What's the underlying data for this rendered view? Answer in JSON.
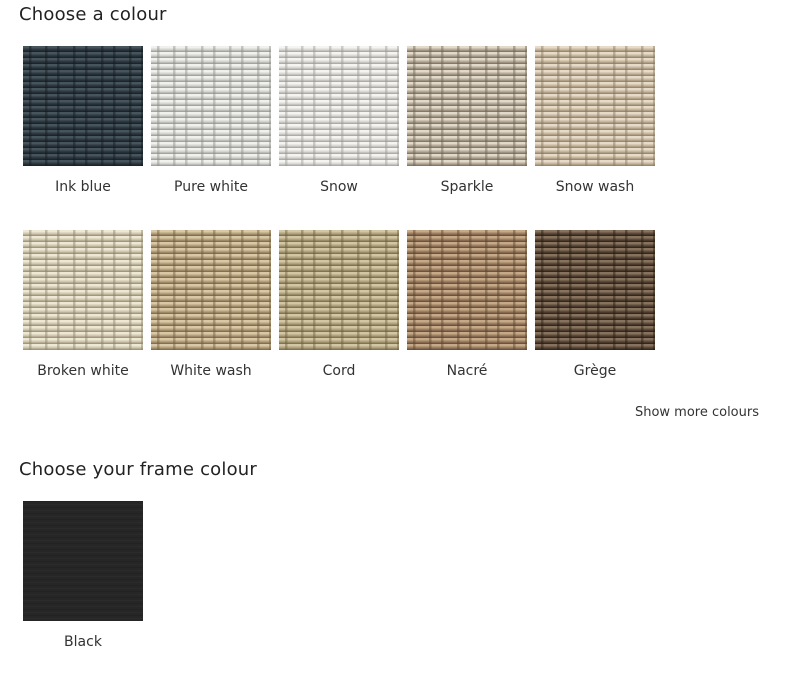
{
  "sections": {
    "weave": {
      "title": "Choose a colour",
      "show_more": "Show more colours",
      "swatches": [
        {
          "name": "Ink blue",
          "base": "#2d3940",
          "light": "#4b5960",
          "dark": "#141b20"
        },
        {
          "name": "Pure white",
          "base": "#d4d4d0",
          "light": "#f4f4f2",
          "dark": "#8f8f8c"
        },
        {
          "name": "Snow",
          "base": "#dcdad6",
          "light": "#f8f8f6",
          "dark": "#9a9894"
        },
        {
          "name": "Sparkle",
          "base": "#b8ab9a",
          "light": "#e8e0d2",
          "dark": "#6e6253"
        },
        {
          "name": "Snow wash",
          "base": "#c7b79e",
          "light": "#ebe1cf",
          "dark": "#85765f"
        },
        {
          "name": "Broken white",
          "base": "#d0c8b0",
          "light": "#f2ecda",
          "dark": "#8c8168"
        },
        {
          "name": "White wash",
          "base": "#b59f7c",
          "light": "#dfcfae",
          "dark": "#6f5b3e"
        },
        {
          "name": "Cord",
          "base": "#b1a37e",
          "light": "#d9cda8",
          "dark": "#6b5f40"
        },
        {
          "name": "Nacré",
          "base": "#9c7e60",
          "light": "#cdb08f",
          "dark": "#5a4230"
        },
        {
          "name": "Grège",
          "base": "#5b4a3a",
          "light": "#8f7a64",
          "dark": "#231a12"
        }
      ]
    },
    "frame": {
      "title": "Choose your frame colour",
      "swatches": [
        {
          "name": "Black",
          "base": "#262626",
          "light": "#2f2f2f",
          "dark": "#1e1e1e",
          "plain": true
        }
      ]
    }
  }
}
